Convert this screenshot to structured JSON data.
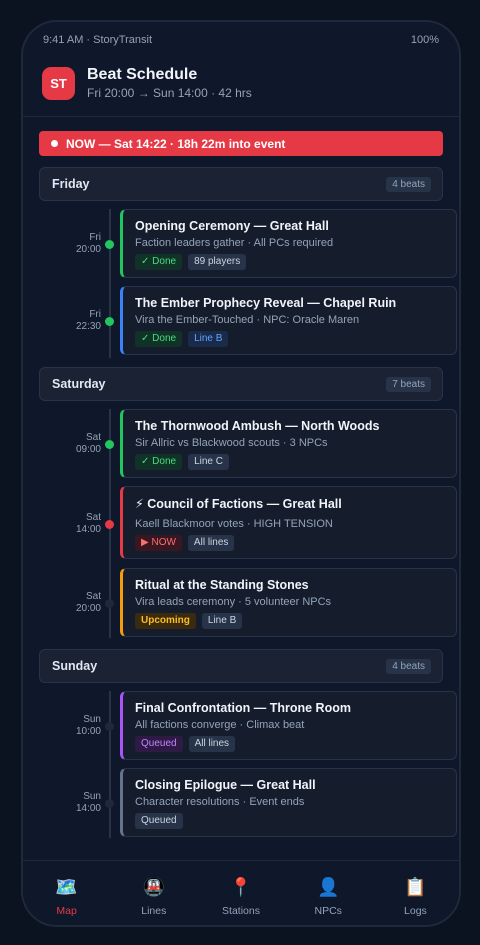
{
  "status": {
    "left": "9:41 AM · StoryTransit",
    "right": "100%"
  },
  "header": {
    "logo": "ST",
    "title": "Beat Schedule",
    "subtitle": "Fri 20:00 → Sun 14:00 · 42 hrs"
  },
  "now_banner": "NOW — Sat 14:22 · 18h 22m into event",
  "days": [
    {
      "name": "Friday",
      "count": "4 beats"
    },
    {
      "name": "Saturday",
      "count": "7 beats"
    },
    {
      "name": "Sunday",
      "count": "4 beats"
    }
  ],
  "beats": [
    {
      "day": "Fri",
      "time": "20:00",
      "title": "Opening Ceremony — Great Hall",
      "desc": "Faction leaders gather · All PCs required",
      "status": "✓ Done",
      "tag": "89 players"
    },
    {
      "day": "Fri",
      "time": "22:30",
      "title": "The Ember Prophecy Reveal — Chapel Ruin",
      "desc": "Vira the Ember-Touched · NPC: Oracle Maren",
      "status": "✓ Done",
      "tag": "Line B"
    },
    {
      "day": "Sat",
      "time": "09:00",
      "title": "The Thornwood Ambush — North Woods",
      "desc": "Sir Allric vs Blackwood scouts · 3 NPCs",
      "status": "✓ Done",
      "tag": "Line C"
    },
    {
      "day": "Sat",
      "time": "14:00",
      "title": "⚡ Council of Factions — Great Hall",
      "desc": "Kaell Blackmoor votes · HIGH TENSION",
      "status": "▶ NOW",
      "tag": "All lines"
    },
    {
      "day": "Sat",
      "time": "20:00",
      "title": "Ritual at the Standing Stones",
      "desc": "Vira leads ceremony · 5 volunteer NPCs",
      "status": "Upcoming",
      "tag": "Line B"
    },
    {
      "day": "Sun",
      "time": "10:00",
      "title": "Final Confrontation — Throne Room",
      "desc": "All factions converge · Climax beat",
      "status": "Queued",
      "tag": "All lines"
    },
    {
      "day": "Sun",
      "time": "14:00",
      "title": "Closing Epilogue — Great Hall",
      "desc": "Character resolutions · Event ends",
      "status": "Queued"
    }
  ],
  "colors": {
    "accent": "#e63946",
    "done": "#22c55e",
    "now": "#e63946",
    "upcoming": "#f59e0b",
    "queued": "#a855f7",
    "line_b": "#3b82f6",
    "muted": "#64748b"
  },
  "tabs": [
    {
      "icon": "🗺️",
      "label": "Map"
    },
    {
      "icon": "🚇",
      "label": "Lines"
    },
    {
      "icon": "📍",
      "label": "Stations"
    },
    {
      "icon": "👤",
      "label": "NPCs"
    },
    {
      "icon": "📋",
      "label": "Logs"
    }
  ]
}
